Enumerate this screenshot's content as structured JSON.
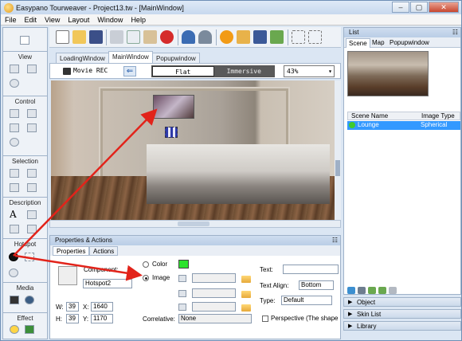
{
  "window": {
    "title": "Easypano Tourweaver - Project13.tw - [MainWindow]",
    "min": "–",
    "max": "▢",
    "close": "✕"
  },
  "menu": [
    "File",
    "Edit",
    "View",
    "Layout",
    "Window",
    "Help"
  ],
  "toolbox": {
    "view": "View",
    "control": "Control",
    "selection": "Selection",
    "description": "Description",
    "hotspot": "Hotspot",
    "media": "Media",
    "effect": "Effect",
    "description_text_icon": "A"
  },
  "editor_tabs": [
    "LoadingWindow",
    "MainWindow",
    "Popupwindow"
  ],
  "viewbar": {
    "movie_rec": "Movie REC",
    "back": "⇐",
    "mode_flat": "Flat",
    "mode_immersive": "Immersive",
    "zoom": "43%",
    "zoom_arrow": "▾"
  },
  "props": {
    "title": "Properties & Actions",
    "pin": "☷",
    "tabs": [
      "Properties",
      "Actions"
    ],
    "component_label": "Component:",
    "component_value": "Hotspot2",
    "w_label": "W:",
    "w_value": "39",
    "h_label": "H:",
    "h_value": "39",
    "x_label": "X:",
    "x_value": "1640",
    "y_label": "Y:",
    "y_value": "1170",
    "color_label": "Color",
    "image_label": "Image",
    "correlative_label": "Correlative:",
    "correlative_value": "None",
    "text_label": "Text:",
    "text_align_label": "Text Align:",
    "text_align_value": "Bottom",
    "type_label": "Type:",
    "type_value": "Default",
    "perspective_label": "Perspective (The shape",
    "green_color": "#2ee32e"
  },
  "list": {
    "title": "List",
    "pin": "☷",
    "tabs": [
      "Scene",
      "Map",
      "Popupwindow"
    ],
    "columns": [
      "Scene Name",
      "Image Type"
    ],
    "rows": [
      {
        "name": "Lounge",
        "type": "Spherical"
      }
    ],
    "selected_color": "#3399ff"
  },
  "accordion": [
    "Object",
    "Skin List",
    "Library"
  ],
  "accordion_arrow": "▶",
  "annotation_color": "#e2231a"
}
